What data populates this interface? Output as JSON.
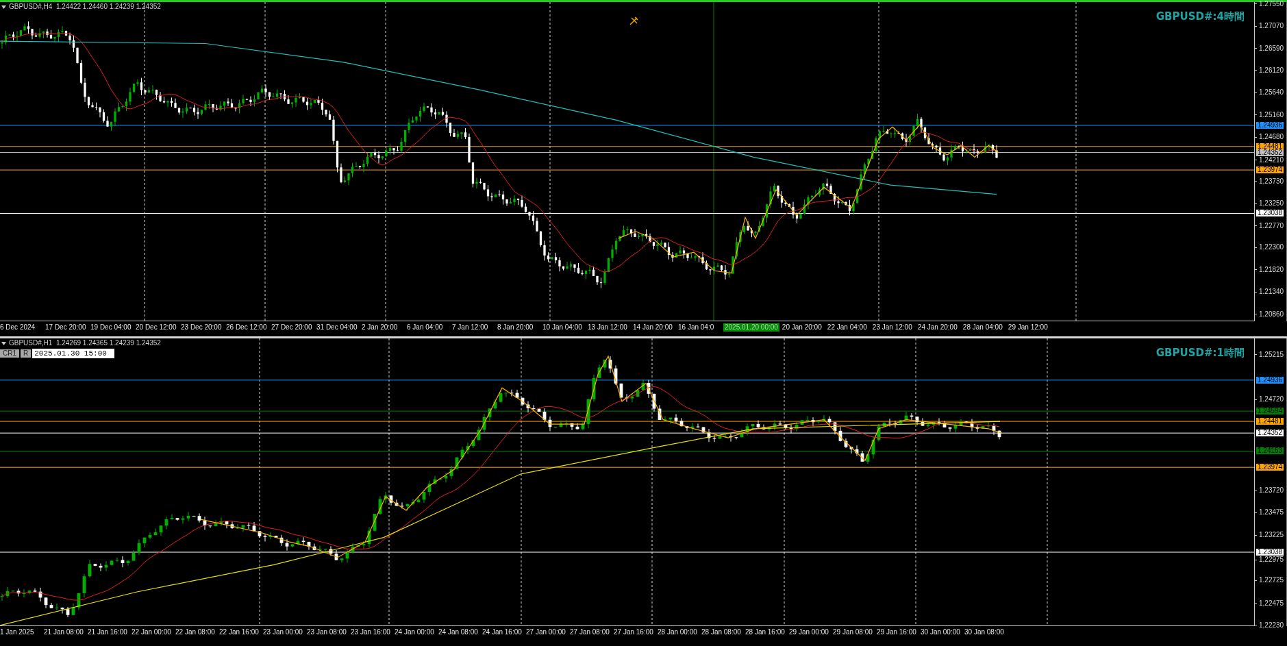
{
  "panels": [
    {
      "kind": "h4",
      "header": "GBPUSD#,H4  1.24422 1.24460 1.24239 1.24352",
      "symbol_label": "GBPUSD#:4時間",
      "price_ticks": [
        "1.27550",
        "1.27070",
        "1.26590",
        "1.26120",
        "1.25640",
        "1.25160",
        "1.24680",
        "1.24210",
        "1.23730",
        "1.23250",
        "1.22770",
        "1.22300",
        "1.21820",
        "1.21340",
        "1.20860"
      ],
      "price_tags": [
        {
          "price": "1.24936",
          "color": "#1e90ff"
        },
        {
          "price": "1.24481",
          "color": "#ffa500"
        },
        {
          "price": "1.24352",
          "color": "#c0c0c0"
        },
        {
          "price": "1.23974",
          "color": "#ffa500"
        },
        {
          "price": "1.23038",
          "color": "#ffffff"
        }
      ],
      "time_labels": [
        {
          "text": "6 Dec 2024",
          "highlighted": false
        },
        {
          "text": "17 Dec 20:00",
          "highlighted": false
        },
        {
          "text": "19 Dec 04:00",
          "highlighted": false
        },
        {
          "text": "20 Dec 12:00",
          "highlighted": false
        },
        {
          "text": "23 Dec 20:00",
          "highlighted": false
        },
        {
          "text": "26 Dec 12:00",
          "highlighted": false
        },
        {
          "text": "27 Dec 20:00",
          "highlighted": false
        },
        {
          "text": "31 Dec 04:00",
          "highlighted": false
        },
        {
          "text": "2 Jan 20:00",
          "highlighted": false
        },
        {
          "text": "6 Jan 04:00",
          "highlighted": false
        },
        {
          "text": "7 Jan 12:00",
          "highlighted": false
        },
        {
          "text": "8 Jan 20:00",
          "highlighted": false
        },
        {
          "text": "10 Jan 04:00",
          "highlighted": false
        },
        {
          "text": "13 Jan 12:00",
          "highlighted": false
        },
        {
          "text": "14 Jan 20:00",
          "highlighted": false
        },
        {
          "text": "16 Jan 04:0",
          "highlighted": false
        },
        {
          "text": "2025.01.20 00:00",
          "highlighted": true
        },
        {
          "text": "20 Jan 20:00",
          "highlighted": false
        },
        {
          "text": "22 Jan 04:00",
          "highlighted": false
        },
        {
          "text": "23 Jan 12:00",
          "highlighted": false
        },
        {
          "text": "24 Jan 20:00",
          "highlighted": false
        },
        {
          "text": "28 Jan 04:00",
          "highlighted": false
        },
        {
          "text": "29 Jan 12:00",
          "highlighted": false
        }
      ]
    },
    {
      "kind": "h1",
      "header": "GBPUSD#,H1  1.24269 1.24365 1.24239 1.24352",
      "symbol_label": "GBPUSD#:1時間",
      "toolbar": {
        "buttons": [
          "CR1",
          "R"
        ],
        "date_value": "2025.01.30 15:00"
      },
      "price_ticks": [
        "1.25215",
        "1.24720",
        "1.23720",
        "1.23475",
        "1.23225",
        "1.22975",
        "1.22725",
        "1.22475",
        "1.22230"
      ],
      "price_tags": [
        {
          "price": "1.24936",
          "color": "#1e90ff"
        },
        {
          "price": "1.24594",
          "color": "#008000"
        },
        {
          "price": "1.24481",
          "color": "#ffa500"
        },
        {
          "price": "1.24352",
          "color": "#ffffff"
        },
        {
          "price": "1.24153",
          "color": "#008000"
        },
        {
          "price": "1.23974",
          "color": "#ffa500"
        },
        {
          "price": "1.23038",
          "color": "#ffffff"
        }
      ],
      "time_labels": [
        {
          "text": "1 Jan 2025",
          "highlighted": false
        },
        {
          "text": "21 Jan 08:00",
          "highlighted": false
        },
        {
          "text": "21 Jan 16:00",
          "highlighted": false
        },
        {
          "text": "22 Jan 00:00",
          "highlighted": false
        },
        {
          "text": "22 Jan 08:00",
          "highlighted": false
        },
        {
          "text": "22 Jan 16:00",
          "highlighted": false
        },
        {
          "text": "23 Jan 00:00",
          "highlighted": false
        },
        {
          "text": "23 Jan 08:00",
          "highlighted": false
        },
        {
          "text": "23 Jan 16:00",
          "highlighted": false
        },
        {
          "text": "24 Jan 00:00",
          "highlighted": false
        },
        {
          "text": "24 Jan 08:00",
          "highlighted": false
        },
        {
          "text": "24 Jan 16:00",
          "highlighted": false
        },
        {
          "text": "27 Jan 00:00",
          "highlighted": false
        },
        {
          "text": "27 Jan 08:00",
          "highlighted": false
        },
        {
          "text": "27 Jan 16:00",
          "highlighted": false
        },
        {
          "text": "28 Jan 00:00",
          "highlighted": false
        },
        {
          "text": "28 Jan 08:00",
          "highlighted": false
        },
        {
          "text": "28 Jan 16:00",
          "highlighted": false
        },
        {
          "text": "29 Jan 00:00",
          "highlighted": false
        },
        {
          "text": "29 Jan 08:00",
          "highlighted": false
        },
        {
          "text": "29 Jan 16:00",
          "highlighted": false
        },
        {
          "text": "30 Jan 00:00",
          "highlighted": false
        },
        {
          "text": "30 Jan 08:00",
          "highlighted": false
        }
      ]
    }
  ]
}
